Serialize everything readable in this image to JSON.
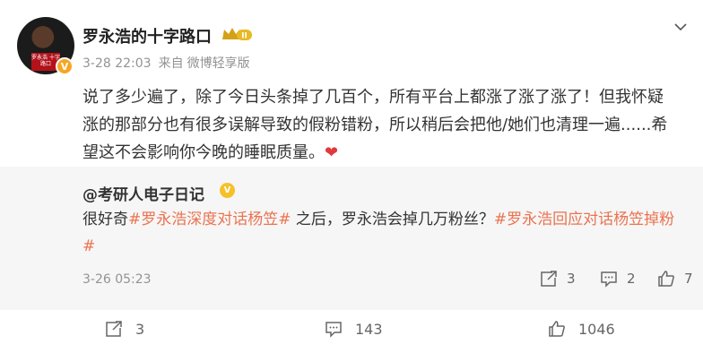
{
  "post": {
    "author": "罗永浩的十字路口",
    "crown_label": "II",
    "avatar_label": "罗永浩 十字路口",
    "timestamp": "3-28 22:03",
    "source_prefix": "来自",
    "source": "微博轻享版",
    "content_line1": "说了多少遍了，除了今日头条掉了几百个，所有平台上都涨了涨了涨了！但我怀疑",
    "content_line2": "涨的那部分也有很多误解导致的假粉错粉，所以稍后会把他/她们也清理一遍......希",
    "content_line3": "望这不会影响你今晚的睡眠质量。",
    "heart": "❤"
  },
  "retweet": {
    "author": "@考研人电子日记",
    "badge": "V",
    "text_1": "很好奇",
    "tag_1": "#罗永浩深度对话杨笠#",
    "text_2": "之后，罗永浩会掉几万粉丝？",
    "tag_2a": "#罗永浩回应对话杨笠掉粉",
    "tag_2b": "#",
    "timestamp": "3-26 05:23",
    "reposts": "3",
    "comments": "2",
    "likes": "7"
  },
  "footer": {
    "reposts": "3",
    "comments": "143",
    "likes": "1046"
  },
  "colors": {
    "tag": "#eb7350",
    "heart": "#e0393e",
    "retweet_bg": "#f6f6f6",
    "verified_orange": "#f6a623"
  }
}
